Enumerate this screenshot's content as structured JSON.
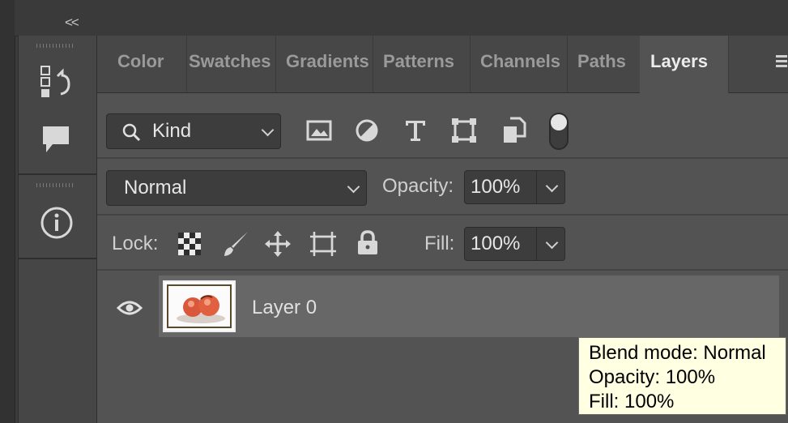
{
  "toolbar": {
    "collapse_label": "<<",
    "tools": [
      {
        "name": "history-icon"
      },
      {
        "name": "comment-icon"
      },
      {
        "name": "info-icon"
      }
    ]
  },
  "tabs": [
    {
      "label": "Color",
      "active": false
    },
    {
      "label": "Swatches",
      "active": false
    },
    {
      "label": "Gradients",
      "active": false
    },
    {
      "label": "Patterns",
      "active": false
    },
    {
      "label": "Channels",
      "active": false
    },
    {
      "label": "Paths",
      "active": false
    },
    {
      "label": "Layers",
      "active": true
    }
  ],
  "filter": {
    "kind_value": "Kind",
    "icons": [
      "image-filter-icon",
      "adjustment-filter-icon",
      "type-filter-icon",
      "shape-filter-icon",
      "smart-object-filter-icon",
      "filter-toggle-icon"
    ]
  },
  "blend": {
    "mode_value": "Normal",
    "opacity_label": "Opacity:",
    "opacity_value": "100%"
  },
  "lock": {
    "label": "Lock:",
    "fill_label": "Fill:",
    "fill_value": "100%",
    "icons": [
      "lock-transparent-pixels-icon",
      "lock-image-pixels-icon",
      "lock-position-icon",
      "lock-artboard-icon",
      "lock-all-icon"
    ]
  },
  "layers": [
    {
      "name": "Layer 0",
      "visible": true,
      "selected": true
    }
  ],
  "tooltip": {
    "line1": "Blend mode: Normal",
    "line2": "Opacity: 100%",
    "line3": "Fill: 100%"
  },
  "colors": {
    "panel_bg": "#535353",
    "selected_row": "#676767",
    "tooltip_bg": "#ffffe1"
  }
}
